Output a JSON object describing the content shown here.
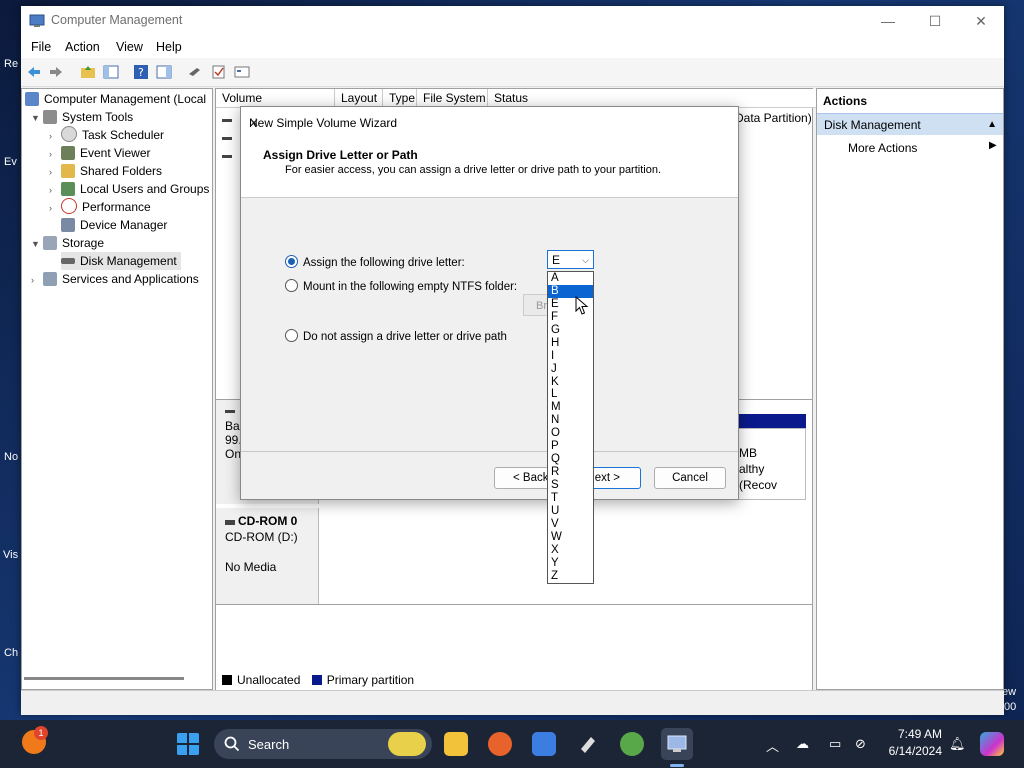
{
  "window": {
    "title": "Computer Management",
    "controls": {
      "minimize": "—",
      "maximize": "☐",
      "close": "✕"
    }
  },
  "menu": [
    "File",
    "Action",
    "View",
    "Help"
  ],
  "tree": {
    "root": "Computer Management (Local",
    "system_tools": "System Tools",
    "task_scheduler": "Task Scheduler",
    "event_viewer": "Event Viewer",
    "shared_folders": "Shared Folders",
    "local_users": "Local Users and Groups",
    "performance": "Performance",
    "device_manager": "Device Manager",
    "storage": "Storage",
    "disk_management": "Disk Management",
    "services": "Services and Applications"
  },
  "volume_columns": [
    "Volume",
    "Layout",
    "Type",
    "File System",
    "Status"
  ],
  "volume_status_partial": "Data Partition)",
  "disk_view": {
    "disk0_line1": "Bas",
    "disk0_line2": "99.",
    "disk0_line3": "On",
    "part_right_line1": "MB",
    "part_right_line2": "althy (Recov",
    "cdrom_title": "CD-ROM 0",
    "cdrom_sub": "CD-ROM (D:)",
    "cdrom_media": "No Media"
  },
  "legend": {
    "unallocated": "Unallocated",
    "primary": "Primary partition"
  },
  "actions": {
    "header": "Actions",
    "selected": "Disk Management",
    "more": "More Actions"
  },
  "wizard": {
    "title": "New Simple Volume Wizard",
    "heading": "Assign Drive Letter or Path",
    "subheading": "For easier access, you can assign a drive letter or drive path to your partition.",
    "option_letter": "Assign the following drive letter:",
    "option_folder": "Mount in the following empty NTFS folder:",
    "option_none": "Do not assign a drive letter or drive path",
    "browse": "Br",
    "back": "< Back",
    "next": "ext >",
    "cancel": "Cancel"
  },
  "dropdown": {
    "selected": "E",
    "highlighted": "B",
    "options": [
      "A",
      "B",
      "E",
      "F",
      "G",
      "H",
      "I",
      "J",
      "K",
      "L",
      "M",
      "N",
      "O",
      "P",
      "Q",
      "R",
      "S",
      "T",
      "U",
      "V",
      "W",
      "X",
      "Y",
      "Z"
    ]
  },
  "desktop_labels": [
    "Re",
    "Ev",
    "No",
    "Vis",
    "Ch"
  ],
  "taskbar": {
    "search": "Search",
    "time": "7:49 AM",
    "date": "6/14/2024",
    "badge": "1",
    "edge_text_1": "ew",
    "edge_text_2": "00"
  },
  "colors": {
    "accent": "#0a64d2",
    "primary_partition": "#0a1a8c",
    "unallocated": "#000000"
  }
}
